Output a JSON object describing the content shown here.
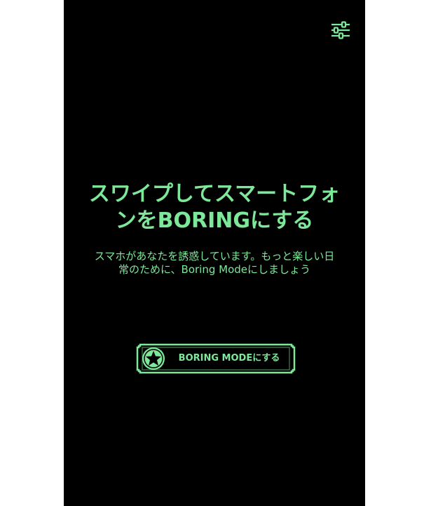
{
  "settings": {
    "icon": "sliders-icon"
  },
  "hero": {
    "title": "スワイプしてスマートフォンをBORINGにする",
    "subtitle": "スマホがあなたを誘惑しています。もっと楽しい日常のために、Boring Modeにしましょう"
  },
  "cta": {
    "icon": "star-icon",
    "label": "BORING MODEにする"
  },
  "colors": {
    "background": "#000000",
    "accent": "#7ee89a"
  }
}
